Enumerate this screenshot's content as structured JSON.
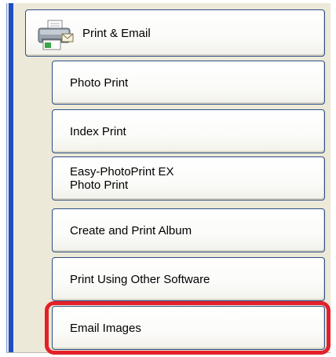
{
  "menu": {
    "main": {
      "label": "Print & Email",
      "icon": "printer-icon"
    },
    "items": [
      {
        "label": "Photo Print"
      },
      {
        "label": "Index Print"
      },
      {
        "label_line1": "Easy-PhotoPrint EX",
        "label_line2": "Photo Print"
      },
      {
        "label": "Create and Print Album"
      },
      {
        "label": "Print Using Other Software"
      },
      {
        "label": "Email Images"
      }
    ]
  },
  "highlight": {
    "target": "Email Images",
    "color": "#e3202a"
  },
  "colors": {
    "panel_bg": "#ece9d8",
    "button_border": "#2e4f86",
    "strip": "#1d4ec8"
  }
}
